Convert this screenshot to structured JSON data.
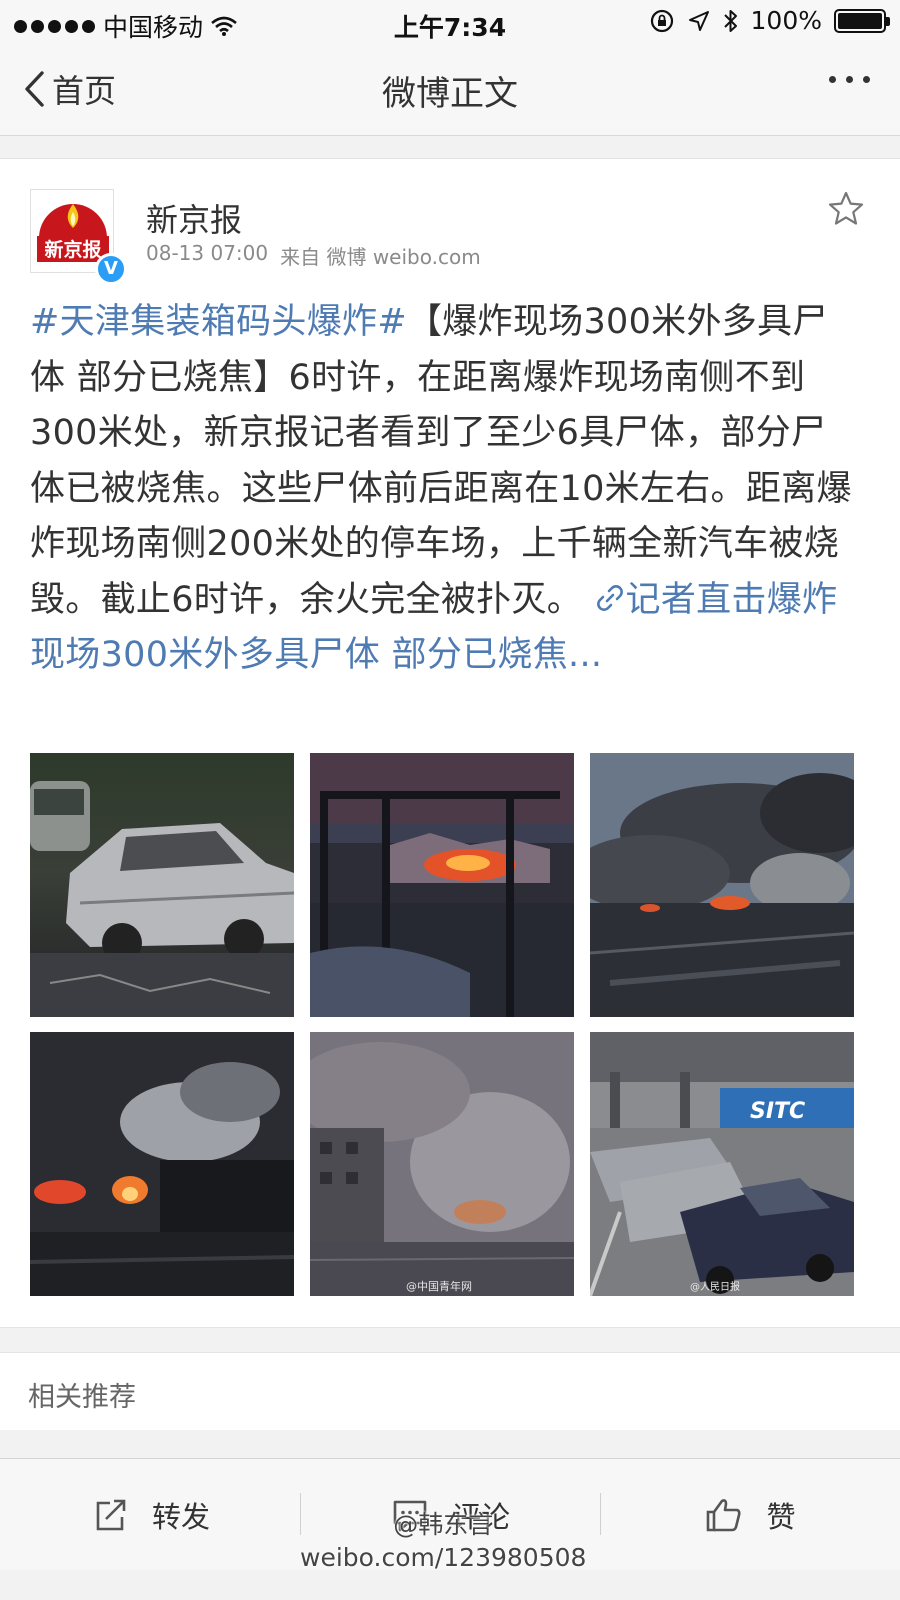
{
  "status_bar": {
    "carrier": "中国移动",
    "time": "上午7:34",
    "battery": "100%",
    "battery_level": 1.0
  },
  "nav": {
    "back_label": "首页",
    "title": "微博正文"
  },
  "post": {
    "author": "新京报",
    "avatar_text": "新京报",
    "verified_badge": "V",
    "date": "08-13 07:00",
    "source_prefix": "来自",
    "source": "微博 weibo.com",
    "hashtag": "#天津集装箱码头爆炸#",
    "text": "【爆炸现场300米外多具尸体 部分已烧焦】6时许，在距离爆炸现场南侧不到300米处，新京报记者看到了至少6具尸体，部分尸体已被烧焦。这些尸体前后距离在10米左右。距离爆炸现场南侧200米处的停车场，上千辆全新汽车被烧毁。截止6时许，余火完全被扑灭。",
    "link_text": "记者直击爆炸现场300米外多具尸体 部分已烧焦...",
    "image_watermarks": [
      "@中国青年网",
      "@人民日报",
      "SITC"
    ]
  },
  "related": {
    "title": "相关推荐"
  },
  "toolbar": {
    "repost": "转发",
    "comment": "评论",
    "like": "赞"
  },
  "watermark": {
    "handle": "@韩东言",
    "url": "weibo.com/123980508"
  },
  "colors": {
    "link": "#4f7bb3",
    "verified": "#2b9df5",
    "brand_red": "#c8161d"
  }
}
